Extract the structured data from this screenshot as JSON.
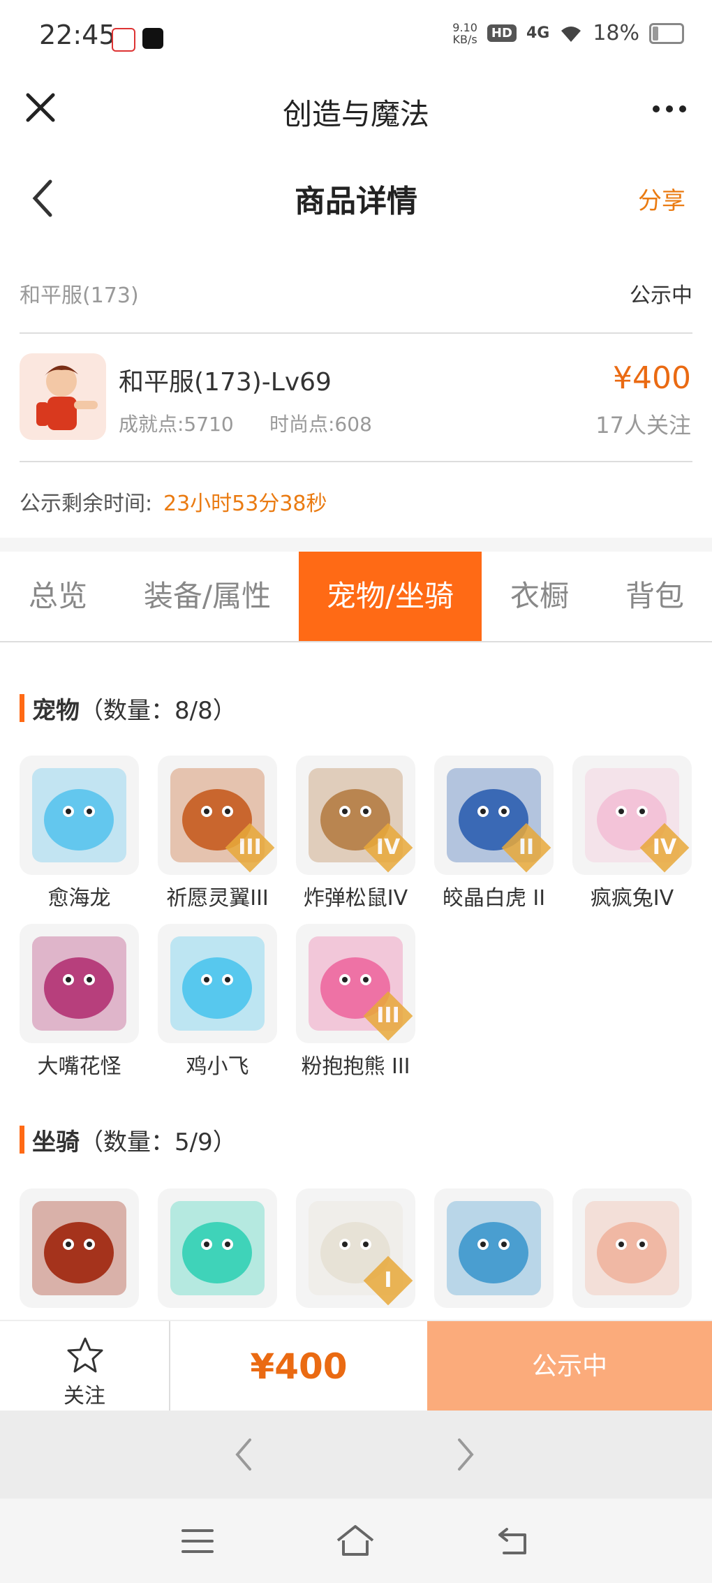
{
  "status_bar": {
    "time": "22:45",
    "net_speed_value": "9.10",
    "net_speed_unit": "KB/s",
    "hd": "HD",
    "network": "4G",
    "battery": "18%"
  },
  "mini_program": {
    "title": "创造与魔法"
  },
  "page": {
    "title": "商品详情",
    "share": "分享"
  },
  "listing": {
    "server": "和平服(173)",
    "status": "公示中",
    "name": "和平服(173)-Lv69",
    "achievement": "成就点:5710",
    "fashion": "时尚点:608",
    "price": "¥400",
    "followers": "17人关注",
    "remaining_label": "公示剩余时间:",
    "remaining_value": "23小时53分38秒"
  },
  "tabs": [
    "总览",
    "装备/属性",
    "宠物/坐骑",
    "衣橱",
    "背包"
  ],
  "active_tab": "宠物/坐骑",
  "pets": {
    "title": "宠物",
    "count": "（数量：8/8）",
    "items": [
      {
        "name": "愈海龙",
        "icon": "blue-dragon-icon",
        "color": "#63c7ee",
        "badge": ""
      },
      {
        "name": "祈愿灵翼III",
        "icon": "eagle-icon",
        "color": "#c9662e",
        "badge": "III"
      },
      {
        "name": "炸弹松鼠IV",
        "icon": "squirrel-icon",
        "color": "#b98550",
        "badge": "IV"
      },
      {
        "name": "皎晶白虎 II",
        "icon": "white-tiger-icon",
        "color": "#3a69b5",
        "badge": "II"
      },
      {
        "name": "疯疯兔IV",
        "icon": "rabbit-icon",
        "color": "#f3c3d8",
        "badge": "IV"
      },
      {
        "name": "大嘴花怪",
        "icon": "flower-monster-icon",
        "color": "#b73f7c",
        "badge": ""
      },
      {
        "name": "鸡小飞",
        "icon": "blue-chick-icon",
        "color": "#57c8ee",
        "badge": ""
      },
      {
        "name": "粉抱抱熊 III",
        "icon": "pink-bear-icon",
        "color": "#ee72a5",
        "badge": "III"
      }
    ]
  },
  "mounts": {
    "title": "坐骑",
    "count": "（数量：5/9）",
    "items": [
      {
        "name": "",
        "icon": "fire-dragon-icon",
        "color": "#a5331c",
        "badge": ""
      },
      {
        "name": "",
        "icon": "green-monster-icon",
        "color": "#3fd3b9",
        "badge": ""
      },
      {
        "name": "",
        "icon": "white-deer-icon",
        "color": "#e7e2d6",
        "badge": "I"
      },
      {
        "name": "",
        "icon": "ice-dragon-icon",
        "color": "#4a9ed0",
        "badge": ""
      },
      {
        "name": "",
        "icon": "pig-icon",
        "color": "#f0b8a4",
        "badge": ""
      }
    ]
  },
  "action_bar": {
    "follow": "关注",
    "price": "¥400",
    "button": "公示中"
  }
}
